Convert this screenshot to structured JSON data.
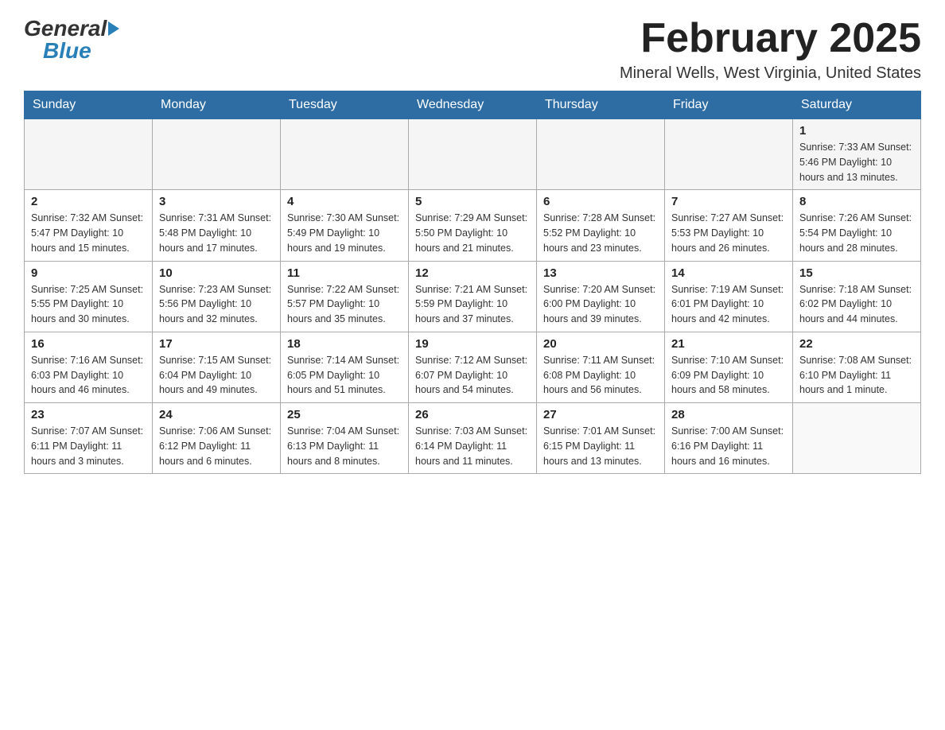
{
  "header": {
    "logo_general": "General",
    "logo_blue": "Blue",
    "month_title": "February 2025",
    "location": "Mineral Wells, West Virginia, United States"
  },
  "days_of_week": [
    "Sunday",
    "Monday",
    "Tuesday",
    "Wednesday",
    "Thursday",
    "Friday",
    "Saturday"
  ],
  "weeks": [
    [
      {
        "day": "",
        "info": ""
      },
      {
        "day": "",
        "info": ""
      },
      {
        "day": "",
        "info": ""
      },
      {
        "day": "",
        "info": ""
      },
      {
        "day": "",
        "info": ""
      },
      {
        "day": "",
        "info": ""
      },
      {
        "day": "1",
        "info": "Sunrise: 7:33 AM\nSunset: 5:46 PM\nDaylight: 10 hours\nand 13 minutes."
      }
    ],
    [
      {
        "day": "2",
        "info": "Sunrise: 7:32 AM\nSunset: 5:47 PM\nDaylight: 10 hours\nand 15 minutes."
      },
      {
        "day": "3",
        "info": "Sunrise: 7:31 AM\nSunset: 5:48 PM\nDaylight: 10 hours\nand 17 minutes."
      },
      {
        "day": "4",
        "info": "Sunrise: 7:30 AM\nSunset: 5:49 PM\nDaylight: 10 hours\nand 19 minutes."
      },
      {
        "day": "5",
        "info": "Sunrise: 7:29 AM\nSunset: 5:50 PM\nDaylight: 10 hours\nand 21 minutes."
      },
      {
        "day": "6",
        "info": "Sunrise: 7:28 AM\nSunset: 5:52 PM\nDaylight: 10 hours\nand 23 minutes."
      },
      {
        "day": "7",
        "info": "Sunrise: 7:27 AM\nSunset: 5:53 PM\nDaylight: 10 hours\nand 26 minutes."
      },
      {
        "day": "8",
        "info": "Sunrise: 7:26 AM\nSunset: 5:54 PM\nDaylight: 10 hours\nand 28 minutes."
      }
    ],
    [
      {
        "day": "9",
        "info": "Sunrise: 7:25 AM\nSunset: 5:55 PM\nDaylight: 10 hours\nand 30 minutes."
      },
      {
        "day": "10",
        "info": "Sunrise: 7:23 AM\nSunset: 5:56 PM\nDaylight: 10 hours\nand 32 minutes."
      },
      {
        "day": "11",
        "info": "Sunrise: 7:22 AM\nSunset: 5:57 PM\nDaylight: 10 hours\nand 35 minutes."
      },
      {
        "day": "12",
        "info": "Sunrise: 7:21 AM\nSunset: 5:59 PM\nDaylight: 10 hours\nand 37 minutes."
      },
      {
        "day": "13",
        "info": "Sunrise: 7:20 AM\nSunset: 6:00 PM\nDaylight: 10 hours\nand 39 minutes."
      },
      {
        "day": "14",
        "info": "Sunrise: 7:19 AM\nSunset: 6:01 PM\nDaylight: 10 hours\nand 42 minutes."
      },
      {
        "day": "15",
        "info": "Sunrise: 7:18 AM\nSunset: 6:02 PM\nDaylight: 10 hours\nand 44 minutes."
      }
    ],
    [
      {
        "day": "16",
        "info": "Sunrise: 7:16 AM\nSunset: 6:03 PM\nDaylight: 10 hours\nand 46 minutes."
      },
      {
        "day": "17",
        "info": "Sunrise: 7:15 AM\nSunset: 6:04 PM\nDaylight: 10 hours\nand 49 minutes."
      },
      {
        "day": "18",
        "info": "Sunrise: 7:14 AM\nSunset: 6:05 PM\nDaylight: 10 hours\nand 51 minutes."
      },
      {
        "day": "19",
        "info": "Sunrise: 7:12 AM\nSunset: 6:07 PM\nDaylight: 10 hours\nand 54 minutes."
      },
      {
        "day": "20",
        "info": "Sunrise: 7:11 AM\nSunset: 6:08 PM\nDaylight: 10 hours\nand 56 minutes."
      },
      {
        "day": "21",
        "info": "Sunrise: 7:10 AM\nSunset: 6:09 PM\nDaylight: 10 hours\nand 58 minutes."
      },
      {
        "day": "22",
        "info": "Sunrise: 7:08 AM\nSunset: 6:10 PM\nDaylight: 11 hours\nand 1 minute."
      }
    ],
    [
      {
        "day": "23",
        "info": "Sunrise: 7:07 AM\nSunset: 6:11 PM\nDaylight: 11 hours\nand 3 minutes."
      },
      {
        "day": "24",
        "info": "Sunrise: 7:06 AM\nSunset: 6:12 PM\nDaylight: 11 hours\nand 6 minutes."
      },
      {
        "day": "25",
        "info": "Sunrise: 7:04 AM\nSunset: 6:13 PM\nDaylight: 11 hours\nand 8 minutes."
      },
      {
        "day": "26",
        "info": "Sunrise: 7:03 AM\nSunset: 6:14 PM\nDaylight: 11 hours\nand 11 minutes."
      },
      {
        "day": "27",
        "info": "Sunrise: 7:01 AM\nSunset: 6:15 PM\nDaylight: 11 hours\nand 13 minutes."
      },
      {
        "day": "28",
        "info": "Sunrise: 7:00 AM\nSunset: 6:16 PM\nDaylight: 11 hours\nand 16 minutes."
      },
      {
        "day": "",
        "info": ""
      }
    ]
  ]
}
